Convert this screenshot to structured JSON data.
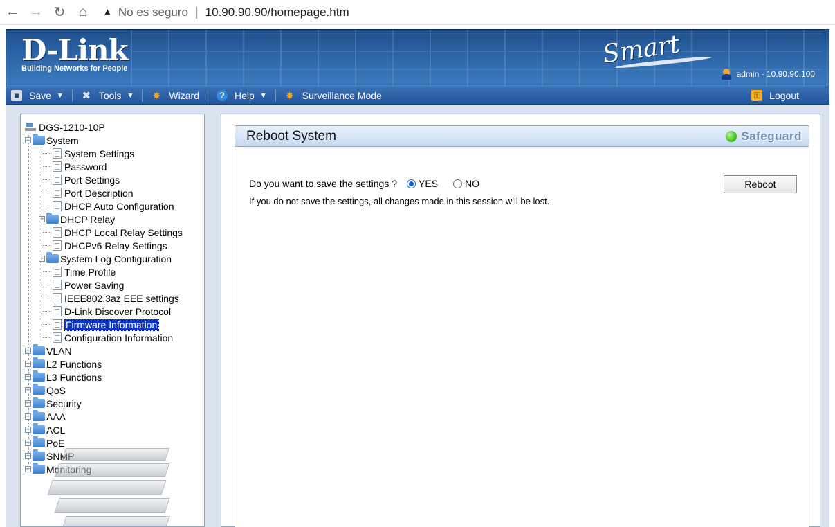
{
  "browser": {
    "security_label": "No es seguro",
    "url": "10.90.90.90/homepage.htm"
  },
  "header": {
    "brand": "D-Link",
    "tagline": "Building Networks for People",
    "product_logo": "Smart",
    "user_info": "admin - 10.90.90.100"
  },
  "toolbar": {
    "save": "Save",
    "tools": "Tools",
    "wizard": "Wizard",
    "help": "Help",
    "surveillance": "Surveillance Mode",
    "logout": "Logout"
  },
  "tree": {
    "device": "DGS-1210-10P",
    "system": "System",
    "system_children": [
      "System Settings",
      "Password",
      "Port Settings",
      "Port Description",
      "DHCP Auto Configuration",
      "DHCP Relay",
      "DHCP Local Relay Settings",
      "DHCPv6 Relay Settings",
      "System Log Configuration",
      "Time Profile",
      "Power Saving",
      "IEEE802.3az EEE settings",
      "D-Link Discover Protocol",
      "Firmware Information",
      "Configuration Information"
    ],
    "top_folders": [
      "VLAN",
      "L2 Functions",
      "L3 Functions",
      "QoS",
      "Security",
      "AAA",
      "ACL",
      "PoE",
      "SNMP",
      "Monitoring"
    ],
    "selected": "Firmware Information"
  },
  "panel": {
    "title": "Reboot System",
    "safeguard": "Safeguard",
    "question": "Do you want to save the settings ?",
    "yes": "YES",
    "no": "NO",
    "selected_option": "YES",
    "warning": "If you do not save the settings, all changes made in this session will be lost.",
    "reboot_button": "Reboot"
  }
}
